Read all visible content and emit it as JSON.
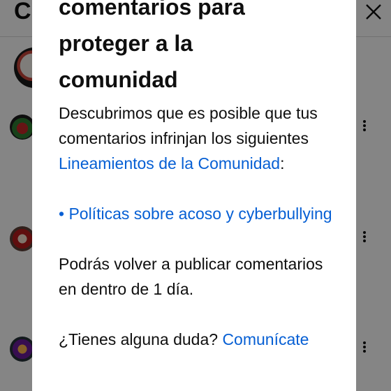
{
  "background": {
    "header_title": "C",
    "close_icon": "close-icon",
    "menu_icon": "more-vert-icon"
  },
  "dialog": {
    "title_line1": "comentarios para",
    "title_line2": "proteger a la",
    "title_line3": "comunidad",
    "intro_before_link": "Descubrimos que es posible que tus comentarios infrinjan los siguientes ",
    "guidelines_link": "Lineamientos de la Comunidad",
    "intro_after_link": ":",
    "policy_link": "• Políticas sobre acoso y cyberbullying",
    "restriction_text": "Podrás volver a publicar comentarios en dentro de 1 día.",
    "question_text": "¿Tienes alguna duda? ",
    "contact_link": "Comunícate"
  },
  "colors": {
    "link": "#065fd4",
    "text": "#0f0f0f",
    "scrim": "rgba(0,0,0,0.48)"
  }
}
